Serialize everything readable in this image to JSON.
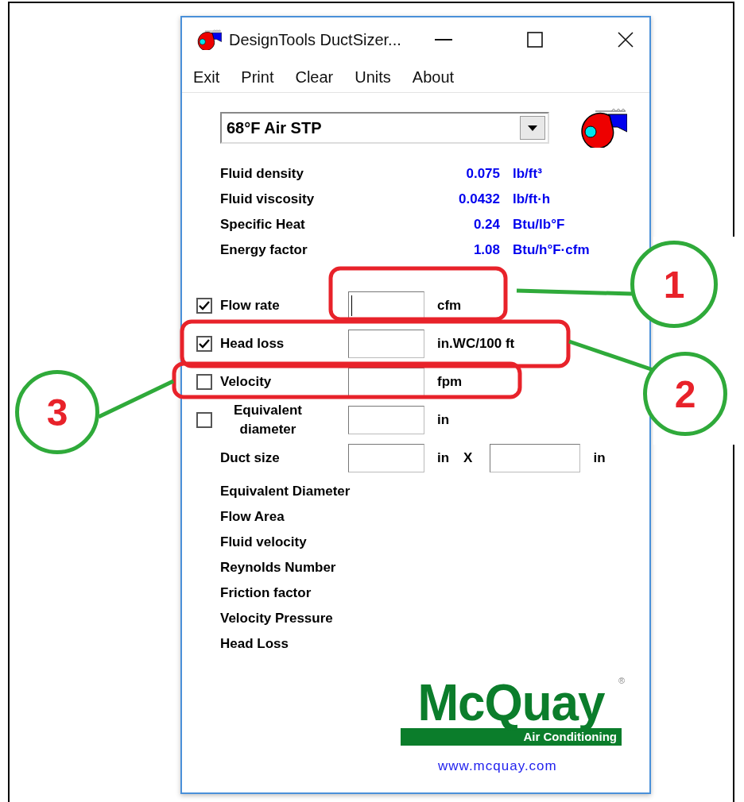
{
  "window": {
    "title": "DesignTools DuctSizer..."
  },
  "menu": [
    "Exit",
    "Print",
    "Clear",
    "Units",
    "About"
  ],
  "fluid_select": {
    "value": "68°F Air STP"
  },
  "properties": [
    {
      "label": "Fluid density",
      "value": "0.075",
      "unit": "lb/ft³"
    },
    {
      "label": "Fluid viscosity",
      "value": "0.0432",
      "unit": "lb/ft·h"
    },
    {
      "label": "Specific Heat",
      "value": "0.24",
      "unit": "Btu/lb°F"
    },
    {
      "label": "Energy factor",
      "value": "1.08",
      "unit": "Btu/h°F·cfm"
    }
  ],
  "inputs": [
    {
      "kind": "checkbox",
      "label": "Flow rate",
      "checked": true,
      "focused": true,
      "unit": "cfm"
    },
    {
      "kind": "checkbox",
      "label": "Head loss",
      "checked": true,
      "focused": false,
      "unit": "in.WC/100 ft"
    },
    {
      "kind": "checkbox",
      "label": "Velocity",
      "checked": false,
      "focused": false,
      "unit": "fpm"
    },
    {
      "kind": "checkbox",
      "label": "Equivalent diameter",
      "checked": false,
      "focused": false,
      "unit": "in"
    },
    {
      "kind": "size",
      "label": "Duct size",
      "unit": "in",
      "separator": "X",
      "unit_2": "in"
    }
  ],
  "results": [
    "Equivalent Diameter",
    "Flow Area",
    "Fluid velocity",
    "Reynolds Number",
    "Friction factor",
    "Velocity Pressure",
    "Head Loss"
  ],
  "logo": {
    "name": "McQuay",
    "mark": "®",
    "tagline": "Air Conditioning"
  },
  "link": "www.mcquay.com",
  "annotations": [
    {
      "number": "1"
    },
    {
      "number": "2"
    },
    {
      "number": "3"
    }
  ]
}
